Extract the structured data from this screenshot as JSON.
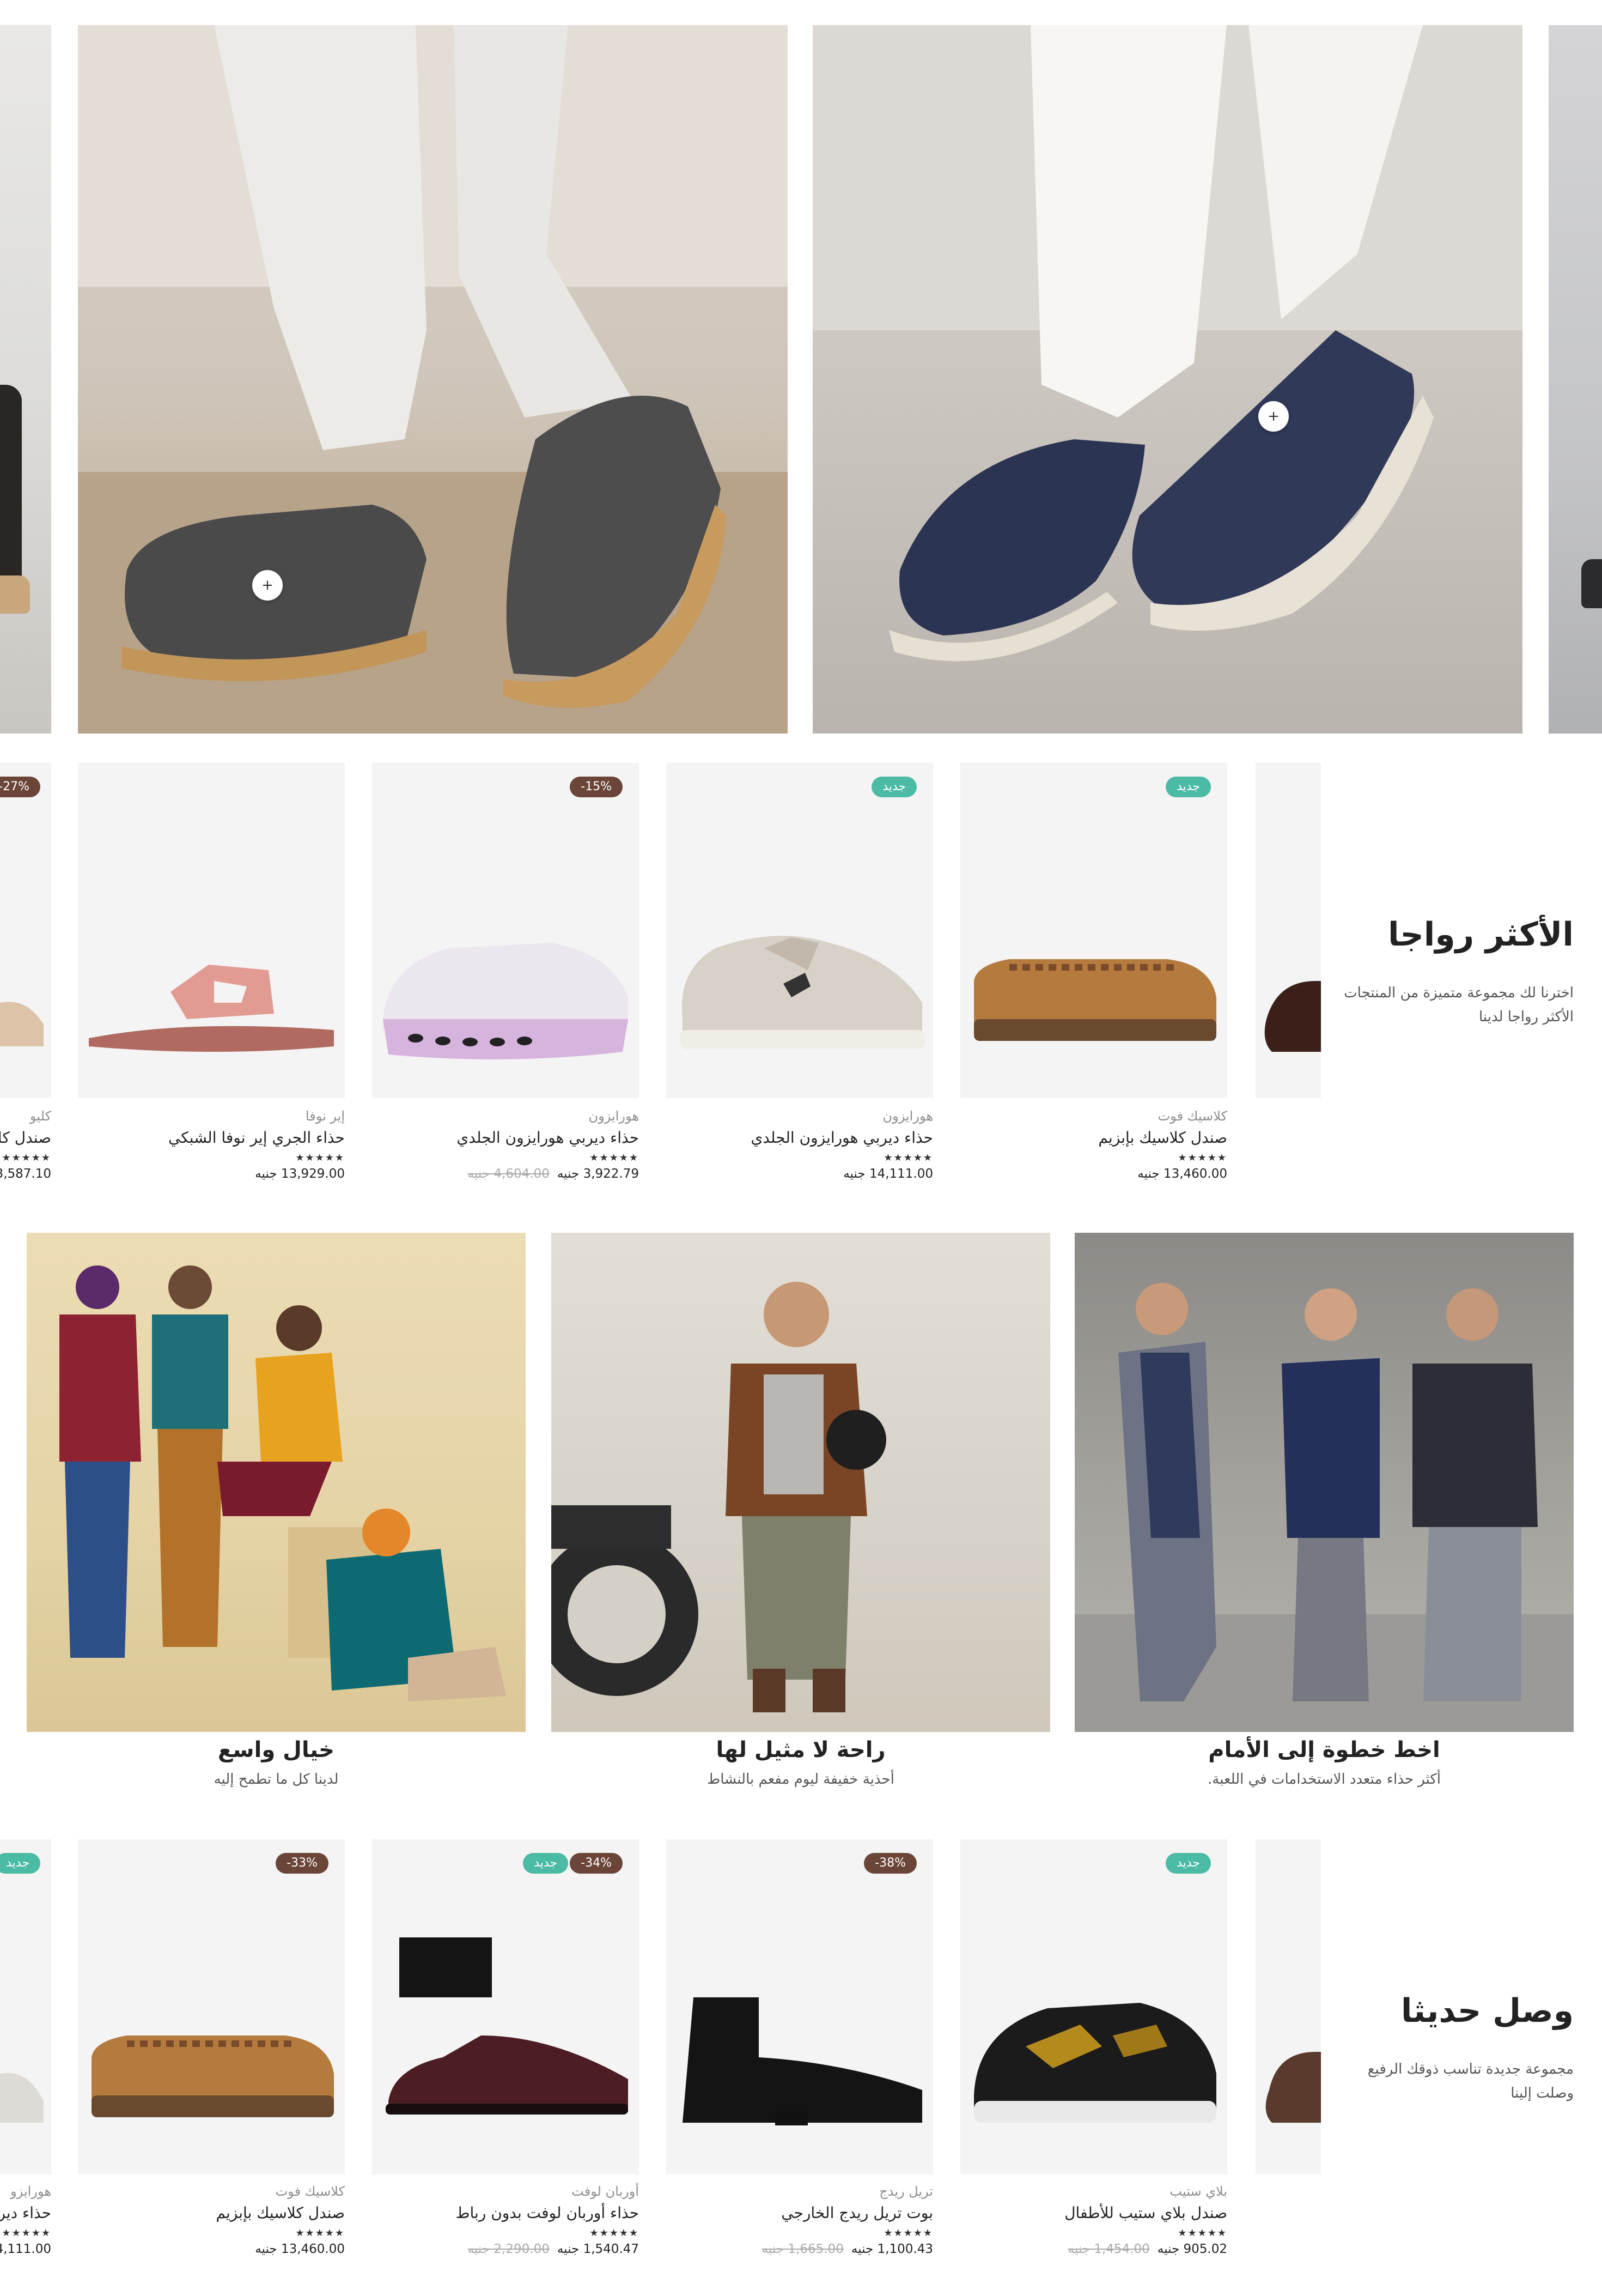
{
  "hero": {
    "hotspot_symbol": "+"
  },
  "trending": {
    "title": "الأكثر رواجا",
    "subtitle_line1": "اخترنا لك مجموعة متميزة من المنتجات",
    "subtitle_line2": "الأكثر رواجا لدينا",
    "products": [
      {
        "brand": "كلاسيك فوت",
        "name": "صندل كلاسيك بإبزيم",
        "stars": "★★★★★",
        "price": "13,460.00 جنيه",
        "old_price": "",
        "badge_new": "جديد",
        "badge_disc": ""
      },
      {
        "brand": "هورايزون",
        "name": "حذاء ديربي هورايزون الجلدي",
        "stars": "★★★★★",
        "price": "14,111.00 جنيه",
        "old_price": "",
        "badge_new": "جديد",
        "badge_disc": ""
      },
      {
        "brand": "هورايزون",
        "name": "حذاء ديربي هورايزون الجلدي",
        "stars": "★★★★★",
        "price": "3,922.79 جنيه",
        "old_price": "4,604.00 جنيه",
        "badge_new": "",
        "badge_disc": "-15%"
      },
      {
        "brand": "إير نوفا",
        "name": "حذاء الجري إير نوفا الشبكي",
        "stars": "★★★★★",
        "price": "13,929.00 جنيه",
        "old_price": "",
        "badge_new": "",
        "badge_disc": ""
      },
      {
        "brand": "كليو",
        "name": "صندل كل",
        "stars": "★★★★★",
        "price": "3,587.10",
        "old_price": "",
        "badge_new": "",
        "badge_disc": "-27%"
      }
    ]
  },
  "categories": [
    {
      "title": "اخط خطوة إلى الأمام",
      "subtitle": "أكثر حذاء متعدد الاستخدامات في اللعبة."
    },
    {
      "title": "راحة لا مثيل لها",
      "subtitle": "أحذية خفيفة ليوم مفعم بالنشاط"
    },
    {
      "title": "خيال واسع",
      "subtitle": "لدينا كل ما تطمح إليه"
    }
  ],
  "new_arrivals": {
    "title": "وصل حديثا",
    "subtitle_line1": "مجموعة جديدة تناسب ذوقك الرفيع",
    "subtitle_line2": "وصلت إلينا",
    "products": [
      {
        "brand": "بلاي ستيب",
        "name": "صندل بلاي ستيب للأطفال",
        "stars": "★★★★★",
        "price": "905.02 جنيه",
        "old_price": "1,454.00 جنيه",
        "badge_new": "جديد",
        "badge_disc": ""
      },
      {
        "brand": "تريل ريدج",
        "name": "بوت تريل ريدج الخارجي",
        "stars": "★★★★★",
        "price": "1,100.43 جنيه",
        "old_price": "1,665.00 جنيه",
        "badge_new": "",
        "badge_disc": "-38%"
      },
      {
        "brand": "أوربان لوفت",
        "name": "حذاء أوربان لوفت بدون رباط",
        "stars": "★★★★★",
        "price": "1,540.47 جنيه",
        "old_price": "2,290.00 جنيه",
        "badge_new": "جديد",
        "badge_disc": "-34%"
      },
      {
        "brand": "كلاسيك فوت",
        "name": "صندل كلاسيك بإبزيم",
        "stars": "★★★★★",
        "price": "13,460.00 جنيه",
        "old_price": "",
        "badge_new": "",
        "badge_disc": "-33%"
      },
      {
        "brand": "هورايزو",
        "name": "حذاء ديرب",
        "stars": "★★★★★",
        "price": "14,111.00",
        "old_price": "",
        "badge_new": "جديد",
        "badge_disc": ""
      }
    ]
  }
}
